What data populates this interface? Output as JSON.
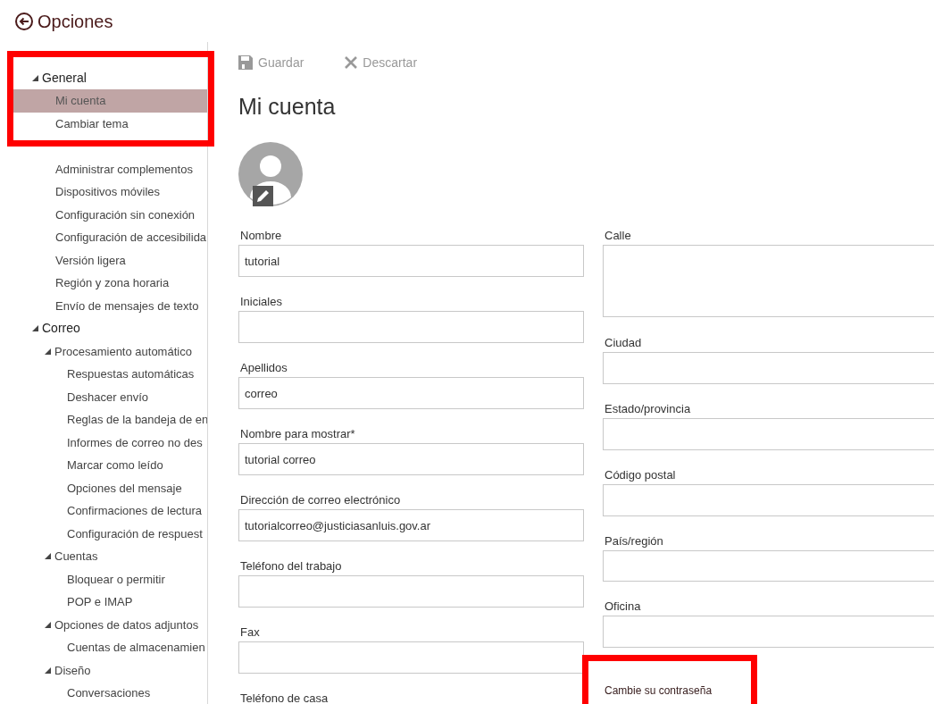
{
  "header": {
    "title": "Opciones"
  },
  "sidebar": {
    "items": [
      {
        "label": "General",
        "expanded": true,
        "selected": false,
        "children": [
          {
            "label": "Mi cuenta",
            "selected": true
          },
          {
            "label": "Cambiar tema",
            "selected": false
          },
          {
            "label": "Administrar complementos",
            "selected": false
          },
          {
            "label": "Dispositivos móviles",
            "selected": false
          },
          {
            "label": "Configuración sin conexión",
            "selected": false
          },
          {
            "label": "Configuración de accesibilida",
            "selected": false
          },
          {
            "label": "Versión ligera",
            "selected": false
          },
          {
            "label": "Región y zona horaria",
            "selected": false
          },
          {
            "label": "Envío de mensajes de texto",
            "selected": false
          }
        ]
      },
      {
        "label": "Correo",
        "expanded": true,
        "selected": false,
        "children": [
          {
            "label": "Procesamiento automático",
            "expanded": true,
            "selected": false,
            "children": [
              {
                "label": "Respuestas automáticas",
                "selected": false
              },
              {
                "label": "Deshacer envío",
                "selected": false
              },
              {
                "label": "Reglas de la bandeja de en",
                "selected": false
              },
              {
                "label": "Informes de correo no des",
                "selected": false
              },
              {
                "label": "Marcar como leído",
                "selected": false
              },
              {
                "label": "Opciones del mensaje",
                "selected": false
              },
              {
                "label": "Confirmaciones de lectura",
                "selected": false
              },
              {
                "label": "Configuración de respuest",
                "selected": false
              }
            ]
          },
          {
            "label": "Cuentas",
            "expanded": true,
            "selected": false,
            "children": [
              {
                "label": "Bloquear o permitir",
                "selected": false
              },
              {
                "label": "POP e IMAP",
                "selected": false
              }
            ]
          },
          {
            "label": "Opciones de datos adjuntos",
            "expanded": true,
            "selected": false,
            "children": [
              {
                "label": "Cuentas de almacenamien",
                "selected": false
              }
            ]
          },
          {
            "label": "Diseño",
            "expanded": true,
            "selected": false,
            "children": [
              {
                "label": "Conversaciones",
                "selected": false
              }
            ]
          }
        ]
      }
    ]
  },
  "toolbar": {
    "buttons": [
      {
        "kind": "save",
        "label": "Guardar"
      },
      {
        "kind": "discard",
        "label": "Descartar"
      }
    ]
  },
  "page_title": "Mi cuenta",
  "form": {
    "left": [
      {
        "kind": "text",
        "label": "Nombre",
        "value": "tutorial"
      },
      {
        "kind": "text",
        "label": "Iniciales"
      },
      {
        "kind": "text",
        "label": "Apellidos",
        "value": "correo"
      },
      {
        "kind": "text",
        "label": "Nombre para mostrar*",
        "value": "tutorial correo"
      },
      {
        "kind": "text",
        "label": "Dirección de correo electrónico",
        "value": "tutorialcorreo@justiciasanluis.gov.ar"
      },
      {
        "kind": "text",
        "label": "Teléfono del trabajo"
      },
      {
        "kind": "text",
        "label": "Fax"
      },
      {
        "kind": "label",
        "label": "Teléfono de casa"
      }
    ],
    "right": [
      {
        "kind": "textarea",
        "label": "Calle"
      },
      {
        "kind": "text",
        "label": "Ciudad"
      },
      {
        "kind": "text",
        "label": "Estado/provincia"
      },
      {
        "kind": "text",
        "label": "Código postal"
      },
      {
        "kind": "select",
        "label": "País/región"
      },
      {
        "kind": "text",
        "label": "Oficina"
      }
    ],
    "password_link": "Cambie su contraseña"
  }
}
